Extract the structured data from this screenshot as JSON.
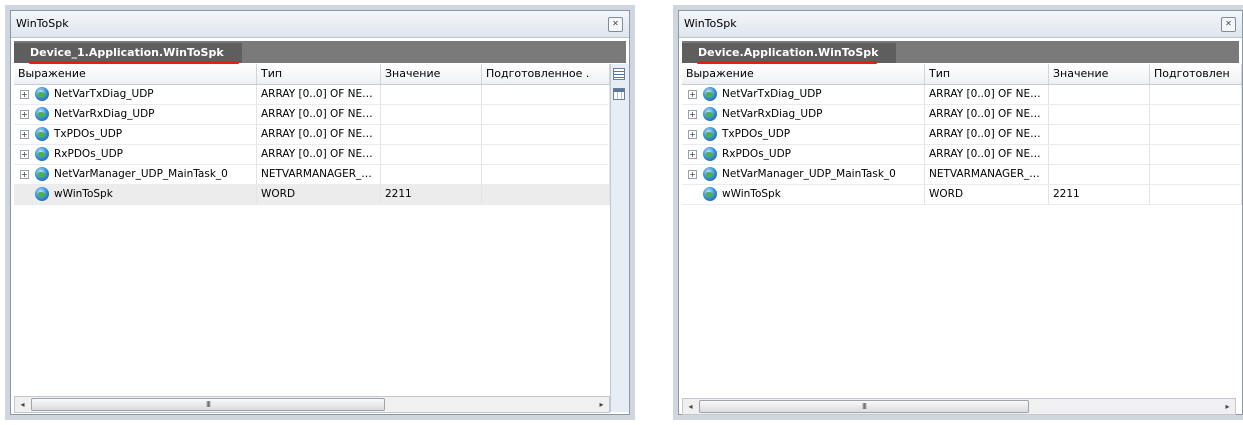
{
  "windows": [
    {
      "title": "WinToSpk",
      "close_icon": "close-icon",
      "device_path": "Device_1.Application.WinToSpk",
      "columns": [
        "Выражение",
        "Тип",
        "Значение",
        "Подготовленное ."
      ],
      "rows": [
        {
          "expression": "NetVarTxDiag_UDP",
          "type": "ARRAY [0..0] OF NE…",
          "value": "",
          "prepared": "",
          "expand": "+"
        },
        {
          "expression": "NetVarRxDiag_UDP",
          "type": "ARRAY [0..0] OF NE…",
          "value": "",
          "prepared": "",
          "expand": "+"
        },
        {
          "expression": "TxPDOs_UDP",
          "type": "ARRAY [0..0] OF NE…",
          "value": "",
          "prepared": "",
          "expand": "+"
        },
        {
          "expression": "RxPDOs_UDP",
          "type": "ARRAY [0..0] OF NE…",
          "value": "",
          "prepared": "",
          "expand": "+"
        },
        {
          "expression": "NetVarManager_UDP_MainTask_0",
          "type": "NETVARMANAGER_…",
          "value": "",
          "prepared": "",
          "expand": "+"
        },
        {
          "expression": "wWinToSpk",
          "type": "WORD",
          "value": "2211",
          "prepared": "",
          "expand": ""
        }
      ],
      "scroll": {
        "left_arrow": "◂",
        "right_arrow": "▸",
        "thumb_grip": "III"
      }
    },
    {
      "title": "WinToSpk",
      "close_icon": "close-icon",
      "device_path": "Device.Application.WinToSpk",
      "columns": [
        "Выражение",
        "Тип",
        "Значение",
        "Подготовлен"
      ],
      "rows": [
        {
          "expression": "NetVarTxDiag_UDP",
          "type": "ARRAY [0..0] OF NE…",
          "value": "",
          "prepared": "",
          "expand": "+"
        },
        {
          "expression": "NetVarRxDiag_UDP",
          "type": "ARRAY [0..0] OF NE…",
          "value": "",
          "prepared": "",
          "expand": "+"
        },
        {
          "expression": "TxPDOs_UDP",
          "type": "ARRAY [0..0] OF NE…",
          "value": "",
          "prepared": "",
          "expand": "+"
        },
        {
          "expression": "RxPDOs_UDP",
          "type": "ARRAY [0..0] OF NE…",
          "value": "",
          "prepared": "",
          "expand": "+"
        },
        {
          "expression": "NetVarManager_UDP_MainTask_0",
          "type": "NETVARMANAGER_…",
          "value": "",
          "prepared": "",
          "expand": "+"
        },
        {
          "expression": "wWinToSpk",
          "type": "WORD",
          "value": "2211",
          "prepared": "",
          "expand": ""
        }
      ],
      "scroll": {
        "left_arrow": "◂",
        "right_arrow": "▸",
        "thumb_grip": "III"
      }
    }
  ],
  "colors": {
    "underline": "#e31d1d",
    "device_bar": "#7a7a7a",
    "device_tab": "#5e5e5e",
    "selected_row": "#ececec"
  },
  "icons": {
    "row_icon": "globe-icon",
    "sidebar": [
      "watch-list-icon",
      "table-view-icon"
    ]
  }
}
